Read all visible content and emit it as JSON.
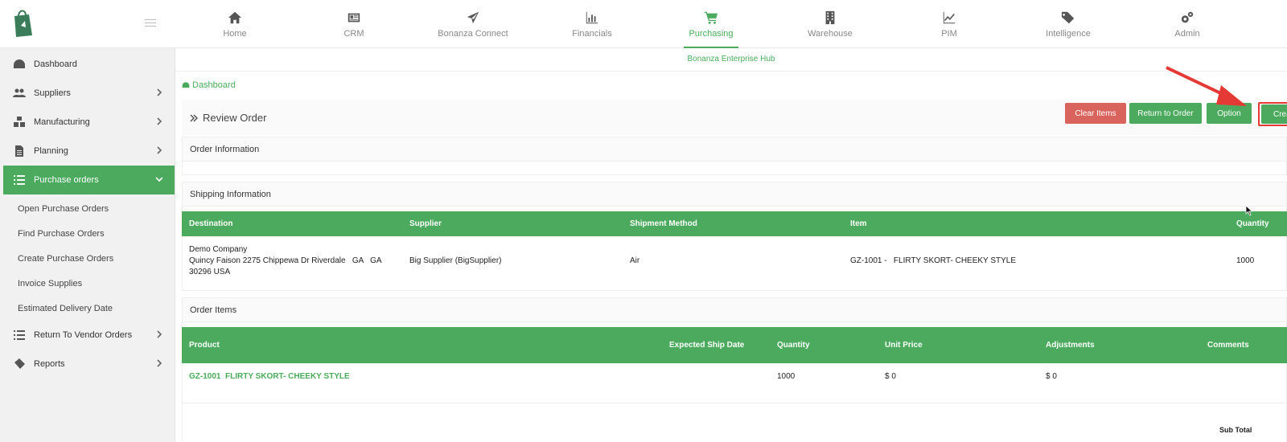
{
  "nav": {
    "items": [
      {
        "label": "Home",
        "icon": "home-icon"
      },
      {
        "label": "CRM",
        "icon": "crm-icon"
      },
      {
        "label": "Bonanza Connect",
        "icon": "paper-plane-icon"
      },
      {
        "label": "Financials",
        "icon": "bar-chart-icon"
      },
      {
        "label": "Purchasing",
        "icon": "shopping-cart-icon",
        "active": true
      },
      {
        "label": "Warehouse",
        "icon": "building-icon"
      },
      {
        "label": "PIM",
        "icon": "line-chart-icon"
      },
      {
        "label": "Intelligence",
        "icon": "tags-icon"
      },
      {
        "label": "Admin",
        "icon": "gears-icon"
      }
    ]
  },
  "sidebar": {
    "items": [
      {
        "label": "Dashboard"
      },
      {
        "label": "Suppliers"
      },
      {
        "label": "Manufacturing"
      },
      {
        "label": "Planning"
      },
      {
        "label": "Purchase orders"
      },
      {
        "label": "Return To Vendor Orders"
      },
      {
        "label": "Reports"
      }
    ],
    "sub_items": [
      "Open Purchase Orders",
      "Find Purchase Orders",
      "Create Purchase Orders",
      "Invoice Supplies",
      "Estimated Delivery Date"
    ]
  },
  "header": {
    "hub_title": "Bonanza Enterprise Hub"
  },
  "breadcrumb": {
    "label": "Dashboard"
  },
  "review": {
    "title": "Review Order",
    "buttons": {
      "clear": "Clear Items",
      "return": "Return to Order",
      "option": "Option",
      "create": "Create"
    }
  },
  "sections": {
    "order_info": "Order Information",
    "shipping_info": "Shipping Information",
    "order_items": "Order Items"
  },
  "shipping_table": {
    "headers": [
      "Destination",
      "Supplier",
      "Shipment Method",
      "Item",
      "Quantity"
    ],
    "row": {
      "dest_line1": "Demo Company",
      "dest_line2": "Quincy Faison 2275 Chippewa Dr Riverdale   GA   GA",
      "dest_line3": "30296 USA",
      "supplier": "Big Supplier (BigSupplier)",
      "method": "Air",
      "item": "GZ-1001 -   FLIRTY SKORT- CHEEKY STYLE",
      "quantity": "1000"
    }
  },
  "items_table": {
    "headers": [
      "Product",
      "Expected Ship Date",
      "Quantity",
      "Unit Price",
      "Adjustments",
      "Comments"
    ],
    "row": {
      "product": "GZ-1001  FLIRTY SKORT- CHEEKY STYLE",
      "ship_date": "",
      "quantity": "1000",
      "unit_price": "$ 0",
      "adjustments": "$ 0"
    }
  },
  "footer": {
    "subtotal_label": "Sub Total"
  },
  "colors": {
    "accent": "#4caa5f",
    "danger": "#d9645d",
    "highlight": "#e53935"
  }
}
